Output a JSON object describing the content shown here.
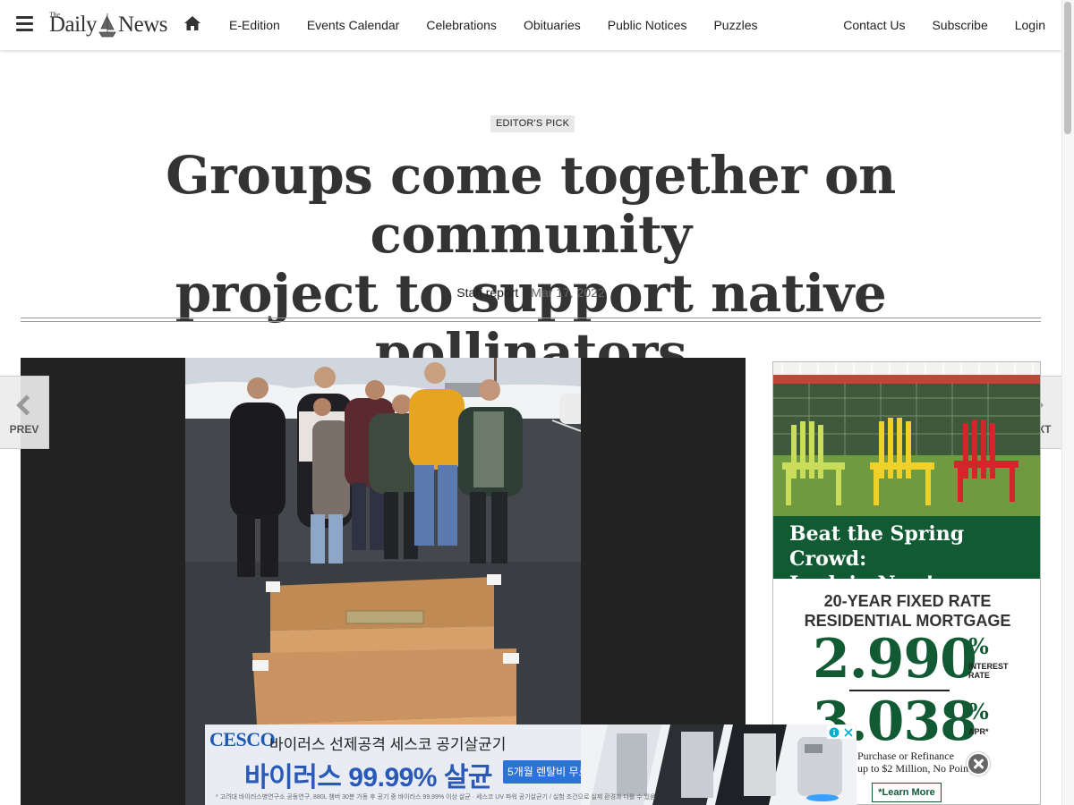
{
  "site": {
    "logo_the": "The",
    "logo_daily": "Daily",
    "logo_news": "News"
  },
  "nav": {
    "links": [
      "E-Edition",
      "Events Calendar",
      "Celebrations",
      "Obituaries",
      "Public Notices",
      "Puzzles"
    ],
    "right_links": [
      "Contact Us",
      "Subscribe",
      "Login"
    ]
  },
  "article": {
    "badge": "EDITOR'S PICK",
    "headline_line1": "Groups come together on community",
    "headline_line2": "project to support native pollinators",
    "author": "Staff report",
    "date": "Mar 17, 2022"
  },
  "gallery": {
    "prev_label": "PREV",
    "next_label": "NEXT"
  },
  "side_ad": {
    "headline_line1": "Beat the Spring Crowd:",
    "headline_line2": "Lock in Now!",
    "fixed_line1": "20-YEAR FIXED RATE",
    "fixed_line2": "RESIDENTIAL MORTGAGE",
    "interest_rate": "2.990",
    "interest_label_1": "INTEREST",
    "interest_label_2": "RATE",
    "apr": "3.038",
    "apr_label": "APR*",
    "percent": "%",
    "purchase_line1": "Purchase or Refinance",
    "purchase_line2": "up to $2 Million, No Points!",
    "learn_more": "*Learn More",
    "colors": {
      "green": "#125a34"
    }
  },
  "banner_ad": {
    "brand": "CESCO",
    "line1": "바이러스 선제공격 세스코 공기살균기",
    "line2": "바이러스 99.99% 살균",
    "cta": "5개월 렌탈비 무료 〉",
    "fine_print": "* 고려대 바이러스병연구소 공동연구, 880L 챔버 30분 가동 후 공기 중 바이러스 99.99% 이상 살균 · 세스코 UV 파워 공기살균기 / 실험 조건으로 실제 환경과 다를 수 있음"
  }
}
